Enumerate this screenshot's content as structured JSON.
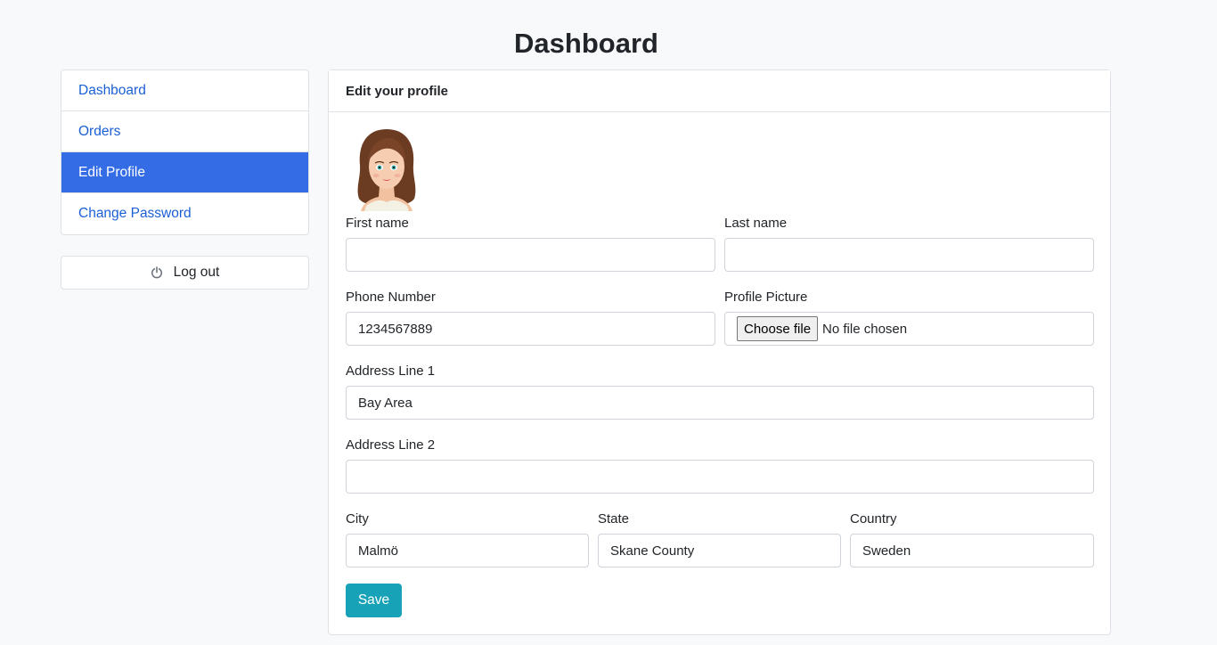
{
  "page": {
    "title": "Dashboard"
  },
  "sidebar": {
    "items": [
      {
        "label": "Dashboard",
        "active": false
      },
      {
        "label": "Orders",
        "active": false
      },
      {
        "label": "Edit Profile",
        "active": true
      },
      {
        "label": "Change Password",
        "active": false
      }
    ],
    "logout_label": "Log out",
    "logout_icon": "power-icon"
  },
  "card": {
    "header": "Edit your profile",
    "avatar_icon": "user-avatar-illustration"
  },
  "form": {
    "first_name": {
      "label": "First name",
      "value": ""
    },
    "last_name": {
      "label": "Last name",
      "value": ""
    },
    "phone": {
      "label": "Phone Number",
      "value": "1234567889"
    },
    "profile_picture": {
      "label": "Profile Picture",
      "button": "Choose file",
      "status": "No file chosen"
    },
    "address1": {
      "label": "Address Line 1",
      "value": "Bay Area"
    },
    "address2": {
      "label": "Address Line 2",
      "value": ""
    },
    "city": {
      "label": "City",
      "value": "Malmö"
    },
    "state": {
      "label": "State",
      "value": "Skane County"
    },
    "country": {
      "label": "Country",
      "value": "Sweden"
    },
    "save_label": "Save"
  },
  "colors": {
    "accent": "#346ce6",
    "link": "#1a5fd6",
    "save": "#17a2b8",
    "background": "#f8f9fa"
  }
}
